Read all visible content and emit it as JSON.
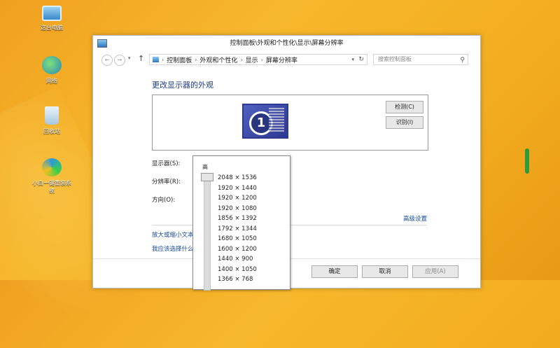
{
  "desktop": {
    "icons": [
      {
        "label": "这台电脑",
        "icon": "computer-icon"
      },
      {
        "label": "网络",
        "icon": "network-icon"
      },
      {
        "label": "回收站",
        "icon": "recycle-bin-icon"
      },
      {
        "label": "小白一键重装系统",
        "icon": "app-icon"
      }
    ]
  },
  "window": {
    "title": "控制面板\\外观和个性化\\显示\\屏幕分辨率",
    "breadcrumb": [
      "控制面板",
      "外观和个性化",
      "显示",
      "屏幕分辨率"
    ],
    "search_placeholder": "搜索控制面板",
    "heading": "更改显示器的外观",
    "monitor_number": "1",
    "detect_label": "检测(C)",
    "identify_label": "识别(I)",
    "display_label": "显示器(S):",
    "resolution_label": "分辨率(R):",
    "orientation_label": "方向(O):",
    "advanced_link": "高级设置",
    "link_text_size": "放大或缩小文本",
    "link_which_settings": "我应该选择什么",
    "ok_label": "确定",
    "cancel_label": "取消",
    "apply_label": "应用(A)"
  },
  "resolution_popup": {
    "high_label": "高",
    "options": [
      "2048 × 1536",
      "1920 × 1440",
      "1920 × 1200",
      "1920 × 1080",
      "1856 × 1392",
      "1792 × 1344",
      "1680 × 1050",
      "1600 × 1200",
      "1440 × 900",
      "1400 × 1050",
      "1366 × 768"
    ]
  },
  "colors": {
    "link": "#1a4ba0",
    "heading": "#1e3a8a",
    "desktop": "#f3ac1f"
  }
}
